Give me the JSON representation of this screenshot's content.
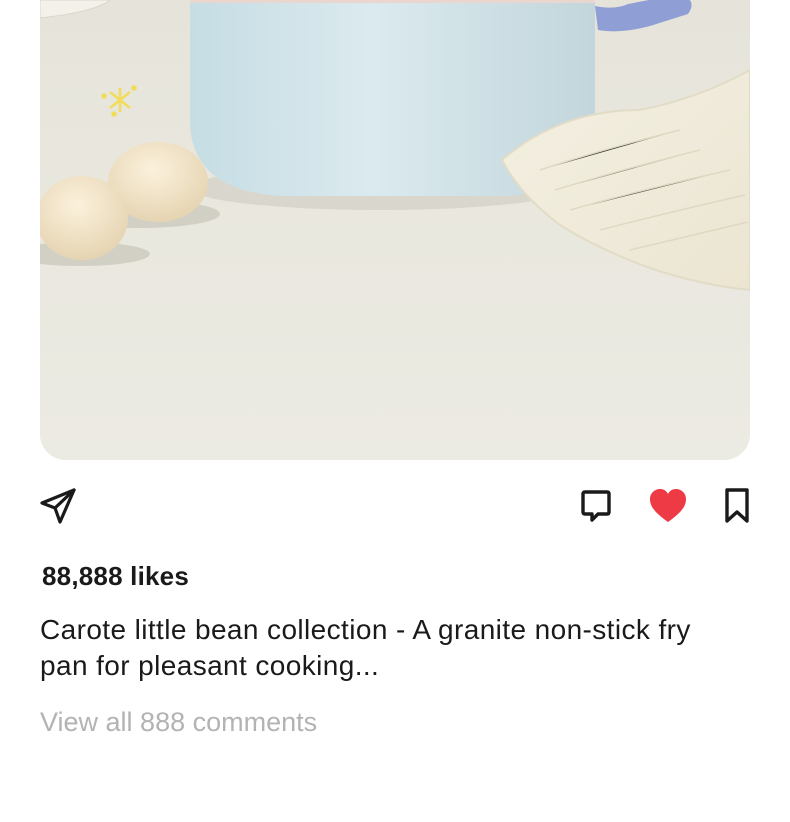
{
  "post": {
    "image_alt": "Light blue pot, eggs and a knitted cloth on a table",
    "likes_text": "88,888 likes",
    "caption": "Carote little bean collection - A granite non-stick fry pan for pleasant cooking...",
    "view_comments": "View all 888 comments"
  },
  "actions": {
    "share_icon": "paper-plane-icon",
    "comment_icon": "comment-bubble-icon",
    "like_icon": "heart-icon",
    "save_icon": "bookmark-icon",
    "liked": true
  },
  "colors": {
    "like_active": "#ee3a45",
    "icon": "#1a1a1a",
    "muted_text": "#b3b3b3",
    "pot": "#cfe0e6",
    "pot_handle": "#8f9fd6",
    "background_table": "#e9e6dc"
  }
}
